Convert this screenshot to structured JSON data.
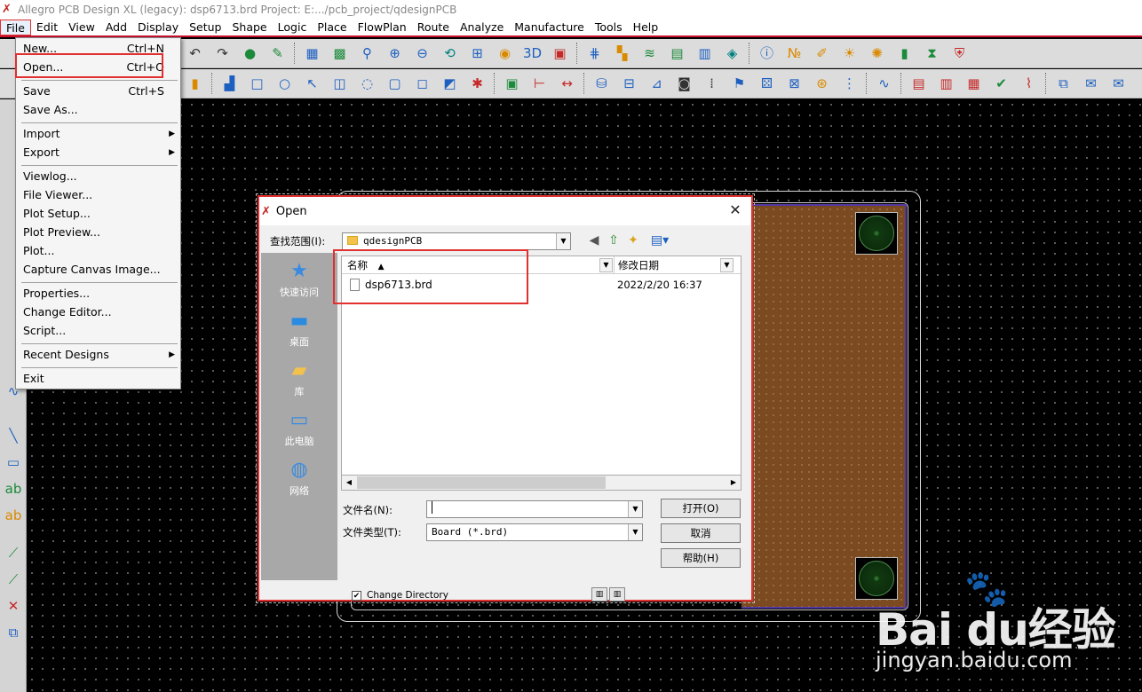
{
  "window": {
    "title": "Allegro PCB Design XL (legacy): dsp6713.brd  Project: E:.../pcb_project/qdesignPCB"
  },
  "menubar": [
    "File",
    "Edit",
    "View",
    "Add",
    "Display",
    "Setup",
    "Shape",
    "Logic",
    "Place",
    "FlowPlan",
    "Route",
    "Analyze",
    "Manufacture",
    "Tools",
    "Help"
  ],
  "file_menu": {
    "items": [
      {
        "label": "New...",
        "shortcut": "Ctrl+N"
      },
      {
        "label": "Open...",
        "shortcut": "Ctrl+O"
      },
      {
        "label": "Save",
        "shortcut": "Ctrl+S"
      },
      {
        "label": "Save As...",
        "shortcut": ""
      },
      {
        "label": "Import",
        "shortcut": ""
      },
      {
        "label": "Export",
        "shortcut": ""
      },
      {
        "label": "Viewlog...",
        "shortcut": ""
      },
      {
        "label": "File Viewer...",
        "shortcut": ""
      },
      {
        "label": "Plot Setup...",
        "shortcut": ""
      },
      {
        "label": "Plot Preview...",
        "shortcut": ""
      },
      {
        "label": "Plot...",
        "shortcut": ""
      },
      {
        "label": "Capture Canvas Image...",
        "shortcut": ""
      },
      {
        "label": "Properties...",
        "shortcut": ""
      },
      {
        "label": "Change Editor...",
        "shortcut": ""
      },
      {
        "label": "Script...",
        "shortcut": ""
      },
      {
        "label": "Recent Designs",
        "shortcut": ""
      },
      {
        "label": "Exit",
        "shortcut": ""
      }
    ]
  },
  "toolbar_icons": {
    "row1": [
      "undo-icon",
      "redo-icon",
      "pin-icon",
      "push-pin-icon",
      "grid-icon",
      "zoom-fit-icon",
      "zoom-area-icon",
      "zoom-in-icon",
      "zoom-out-icon",
      "zoom-prev-icon",
      "zoom-window-icon",
      "refresh-icon",
      "view-3d-icon",
      "flip-icon",
      "grid-dots-icon",
      "color-icon",
      "layer-icon",
      "ecm-icon",
      "dfa-icon",
      "constraint-icon",
      "info-icon",
      "count-123-icon",
      "brush-icon",
      "sun-icon",
      "bulb-icon",
      "bars-icon",
      "hourglass-icon",
      "shield-icon"
    ],
    "row2": [
      "pad-icon",
      "rect-icon",
      "circle-icon",
      "select-icon",
      "shape-icon",
      "ring-icon",
      "square-icon",
      "square2-icon",
      "fill-icon",
      "spread-icon",
      "chip-icon",
      "dim-icon",
      "dim2-icon",
      "odb-icon",
      "book-icon",
      "rule-icon",
      "camera-icon",
      "text-icon",
      "flag-icon",
      "dice-icon",
      "matrix-icon",
      "probe-icon",
      "net-icon",
      "wave-icon",
      "doc-icon",
      "doc2-icon",
      "doc3-icon",
      "doc4-icon",
      "route-icon",
      "pages-icon",
      "mail-icon",
      "mail2-icon",
      "help-icon"
    ]
  },
  "colors": {
    "accent": "#e03030",
    "board": "#7b4a20",
    "canvas": "#000000"
  },
  "dialog": {
    "title": "Open",
    "look_in_label": "查找范围(I):",
    "look_in_value": "qdesignPCB",
    "places": [
      "快速访问",
      "桌面",
      "库",
      "此电脑",
      "网络"
    ],
    "columns": {
      "name": "名称",
      "date": "修改日期"
    },
    "files": [
      {
        "name": "dsp6713.brd",
        "date": "2022/2/20 16:37"
      }
    ],
    "filename_label": "文件名(N):",
    "filename_value": "",
    "filetype_label": "文件类型(T):",
    "filetype_value": "Board (*.brd)",
    "buttons": {
      "open": "打开(O)",
      "cancel": "取消",
      "help": "帮助(H)"
    },
    "checkbox": {
      "label": "Change Directory",
      "checked": true
    }
  },
  "watermark": {
    "brand": "Bai du经验",
    "url": "jingyan.baidu.com"
  }
}
